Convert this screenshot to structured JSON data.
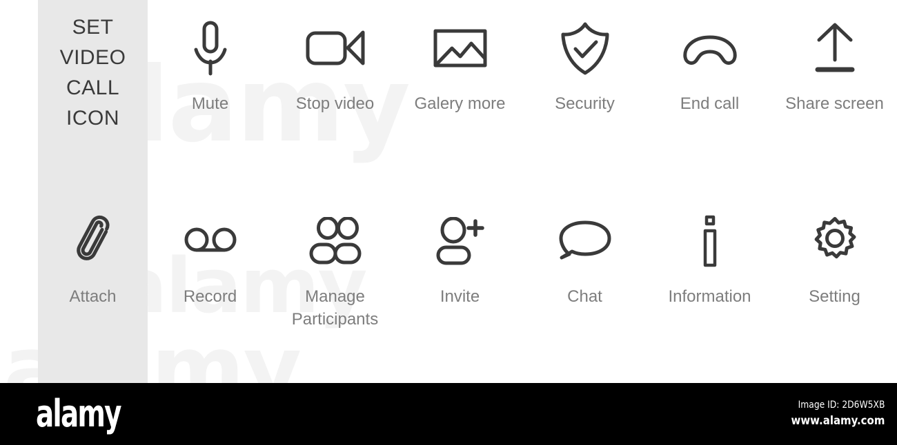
{
  "panel": {
    "title_lines": [
      "SET",
      "VIDEO",
      "CALL",
      "ICON"
    ],
    "background_color": "#e8e8e8",
    "attach": {
      "icon": "paperclip-icon",
      "label": "Attach"
    }
  },
  "colors": {
    "icon_stroke": "#3a3a3a",
    "label_text": "#7d7d7d",
    "title_text": "#3a3a3a",
    "page_background": "#ffffff",
    "footer_background": "#000000"
  },
  "rows": [
    {
      "items": [
        {
          "icon": "microphone-icon",
          "label": "Mute"
        },
        {
          "icon": "video-camera-icon",
          "label": "Stop video"
        },
        {
          "icon": "image-gallery-icon",
          "label": "Galery more"
        },
        {
          "icon": "shield-check-icon",
          "label": "Security"
        },
        {
          "icon": "phone-hangup-icon",
          "label": "End call"
        },
        {
          "icon": "upload-arrow-icon",
          "label": "Share screen"
        }
      ]
    },
    {
      "items": [
        {
          "icon": "voicemail-record-icon",
          "label": "Record"
        },
        {
          "icon": "people-group-icon",
          "label": "Manage\nParticipants"
        },
        {
          "icon": "person-add-icon",
          "label": "Invite"
        },
        {
          "icon": "speech-bubble-icon",
          "label": "Chat"
        },
        {
          "icon": "info-letter-icon",
          "label": "Information"
        },
        {
          "icon": "gear-icon",
          "label": "Setting"
        }
      ]
    }
  ],
  "watermark": {
    "text": "alamy",
    "repeats": [
      "alamy",
      "alamy",
      "alamy"
    ]
  },
  "footer": {
    "logo_text": "alamy",
    "image_id": "Image ID: 2D6W5XB",
    "website": "www.alamy.com"
  }
}
